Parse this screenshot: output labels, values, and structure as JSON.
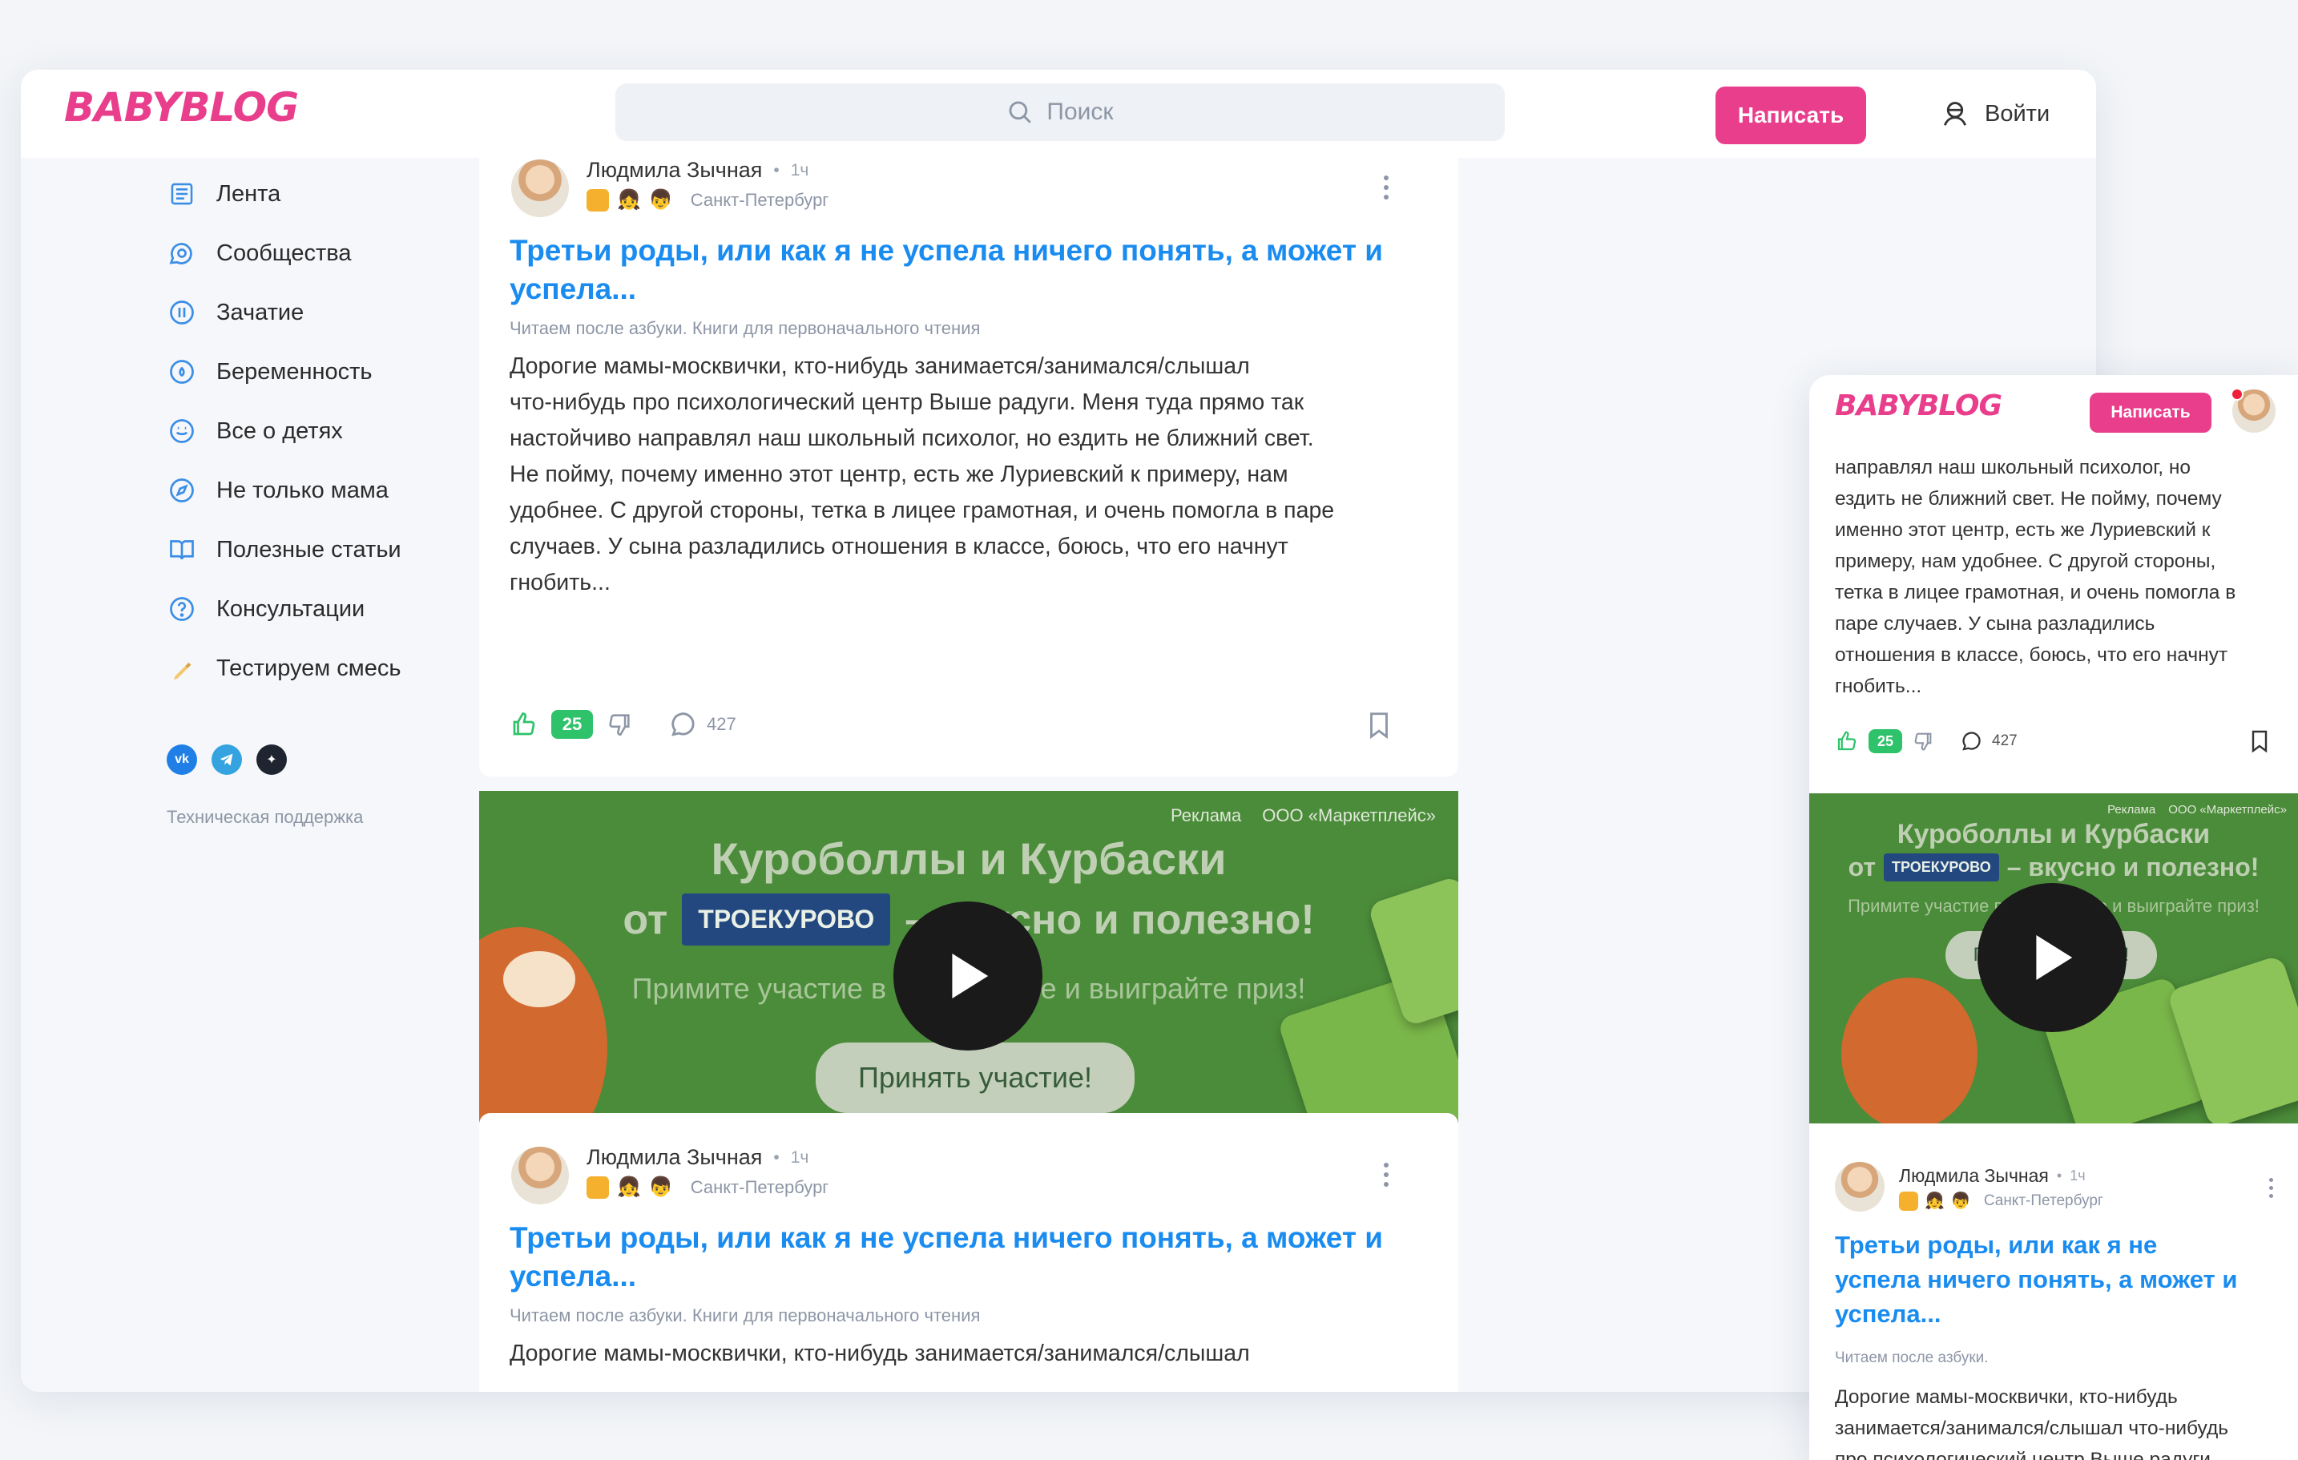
{
  "brand": {
    "logo": "BABYBLOG",
    "color": "#e83e8c",
    "link_color": "#1a8cf0",
    "like_color": "#2ec26a"
  },
  "header": {
    "search_placeholder": "Поиск",
    "write_label": "Написать",
    "login_label": "Войти"
  },
  "sidebar": {
    "items": [
      {
        "label": "Лента",
        "icon": "feed-icon"
      },
      {
        "label": "Сообщества",
        "icon": "community-icon"
      },
      {
        "label": "Зачатие",
        "icon": "conception-icon"
      },
      {
        "label": "Беременность",
        "icon": "pregnancy-icon"
      },
      {
        "label": "Все о детях",
        "icon": "kids-icon"
      },
      {
        "label": "Не только мама",
        "icon": "compass-icon"
      },
      {
        "label": "Полезные статьи",
        "icon": "book-icon"
      },
      {
        "label": "Консультации",
        "icon": "help-icon"
      },
      {
        "label": "Тестируем смесь",
        "icon": "bottle-icon"
      }
    ],
    "socials": [
      "vk-icon",
      "telegram-icon",
      "sparkle-icon"
    ],
    "support_label": "Техническая поддержка"
  },
  "post": {
    "author": "Людмила Зычная",
    "time": "1ч",
    "city": "Санкт-Петербург",
    "title": "Третьи роды, или как я не успела ничего понять, а может и успела...",
    "category": "Читаем после азбуки. Книги для первоначального чтения",
    "category_short": "Читаем после азбуки.",
    "body_lines": [
      "Дорогие мамы-москвички, кто-нибудь занимается/занимался/слышал",
      "что-нибудь про психологический центр Выше радуги. Меня туда прямо так",
      "настойчиво направлял наш школьный психолог, но ездить не ближний свет.",
      "Не пойму, почему именно этот центр, есть же Луриевский к примеру, нам",
      "удобнее. С другой стороны, тетка в лицее грамотная, и очень помогла в паре",
      "случаев. У сына разладились отношения в классе, боюсь, что его начнут",
      "гнобить..."
    ],
    "likes": "25",
    "comments": "427"
  },
  "ad": {
    "label": "Реклама",
    "advertiser": "ООО «Маркетплейс»",
    "line1": "Куроболлы и Курбаски",
    "line2_prefix": "от",
    "brand": "ТРОЕКУРОВО",
    "line2_suffix": "– вкусно и полезно!",
    "line3": "Примите участие в тест-драйве и выиграйте приз!",
    "cta": "Принять участие!",
    "cta_mobile": "Принять участие!"
  },
  "mobile": {
    "write_label": "Написать",
    "body_lines": [
      "направлял наш школьный психолог, но",
      "ездить не ближний свет. Не пойму, почему",
      "именно этот центр, есть же Луриевский к",
      "примеру, нам удобнее. С другой стороны,",
      "тетка в лицее грамотная, и очень помогла в",
      "паре случаев. У сына разладились",
      "отношения в классе, боюсь, что его начнут",
      "гнобить..."
    ],
    "title_lines": [
      "Третьи роды, или как я не",
      "успела ничего понять, а может и",
      "успела..."
    ],
    "post2_lines": [
      "Дорогие мамы-москвички, кто-нибудь",
      "занимается/занимался/слышал что-нибудь",
      "про психологический центр Выше радуги."
    ]
  }
}
